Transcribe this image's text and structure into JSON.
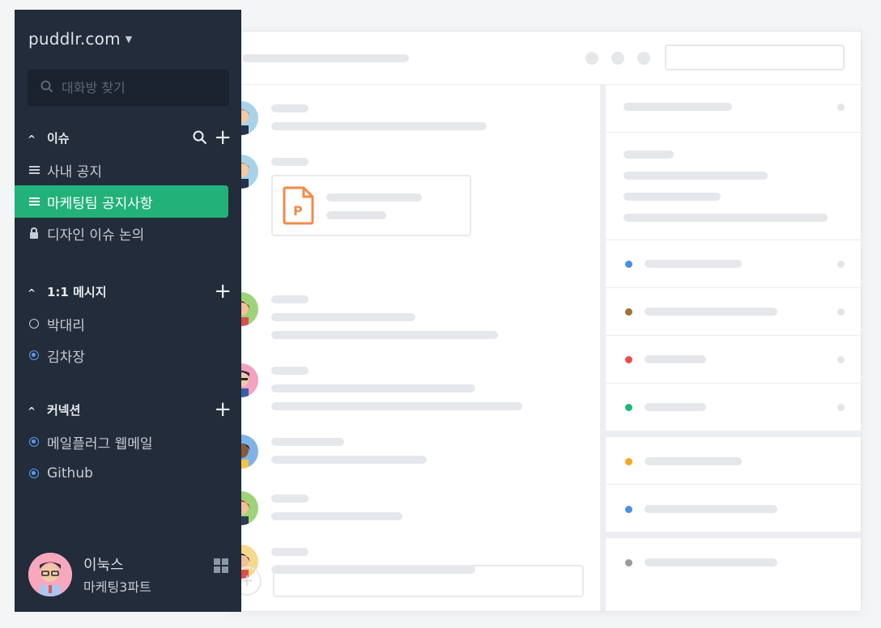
{
  "workspace": {
    "name": "puddlr.com"
  },
  "search": {
    "placeholder": "대화방 찾기"
  },
  "sections": {
    "issues": {
      "title": "이슈",
      "items": [
        {
          "label": "사내 공지",
          "icon": "list-icon"
        },
        {
          "label": "마케팅팀 공지사항",
          "icon": "list-icon",
          "active": true
        },
        {
          "label": "디자인 이슈 논의",
          "icon": "lock-icon"
        }
      ]
    },
    "dm": {
      "title": "1:1 메시지",
      "items": [
        {
          "label": "박대리",
          "status": "offline"
        },
        {
          "label": "김차장",
          "status": "online"
        }
      ]
    },
    "connections": {
      "title": "커넥션",
      "items": [
        {
          "label": "메일플러그 웹메일"
        },
        {
          "label": "Github"
        }
      ]
    }
  },
  "profile": {
    "name": "이눅스",
    "team": "마케팅3파트"
  },
  "file_card": {
    "icon_letter": "P"
  },
  "colors": {
    "sidebar_bg": "#222c3a",
    "active_item": "#23b17a",
    "status_online": "#5b9af0",
    "file_icon": "#f28b4a",
    "right_dots": [
      "#4a90e2",
      "#a0723a",
      "#f04a4a",
      "#1fb57a",
      "#f5a623",
      "#4a90e2",
      "#9b9b9b"
    ]
  }
}
